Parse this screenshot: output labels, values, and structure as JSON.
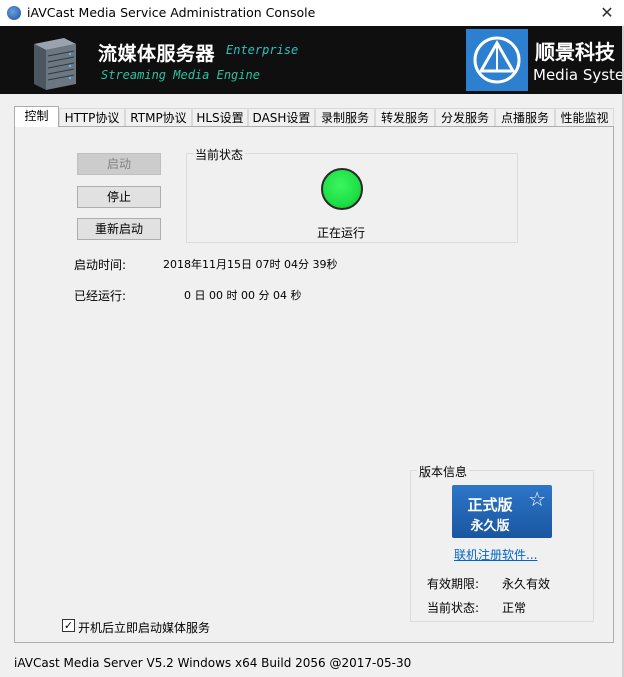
{
  "window": {
    "title": "iAVCast Media Service Administration Console",
    "close_glyph": "✕"
  },
  "banner": {
    "title": "流媒体服务器",
    "edition": "Enterprise",
    "subtitle": "Streaming Media Engine",
    "company_cn": "顺景科技",
    "company_en": "Media Systems",
    "background_color": "#0f0f0f",
    "logo_color": "#2d7fd0"
  },
  "tabs": [
    {
      "label": "控制",
      "active": true
    },
    {
      "label": "HTTP协议"
    },
    {
      "label": "RTMP协议"
    },
    {
      "label": "HLS设置"
    },
    {
      "label": "DASH设置"
    },
    {
      "label": "录制服务"
    },
    {
      "label": "转发服务"
    },
    {
      "label": "分发服务"
    },
    {
      "label": "点播服务"
    },
    {
      "label": "性能监视"
    }
  ],
  "control": {
    "start_label": "启动",
    "stop_label": "停止",
    "restart_label": "重新启动",
    "status_group_title": "当前状态",
    "status_text": "正在运行",
    "status_color": "#1fe046",
    "start_time_label": "启动时间:",
    "start_time_value": "2018年11月15日 07时 04分 39秒",
    "uptime_label": "已经运行:",
    "uptime_value": "0 日 00 时 00 分 04 秒",
    "autostart_label": "开机后立即启动媒体服务",
    "autostart_checked": true,
    "autostart_check_glyph": "✓"
  },
  "version": {
    "group_title": "版本信息",
    "badge_line1": "正式版",
    "badge_line2": "永久版",
    "badge_star": "☆",
    "register_link": "联机注册软件...",
    "validity_label": "有效期限:",
    "validity_value": "永久有效",
    "state_label": "当前状态:",
    "state_value": "正常"
  },
  "statusbar": {
    "text": "iAVCast Media Server V5.2 Windows x64 Build 2056 @2017-05-30"
  }
}
